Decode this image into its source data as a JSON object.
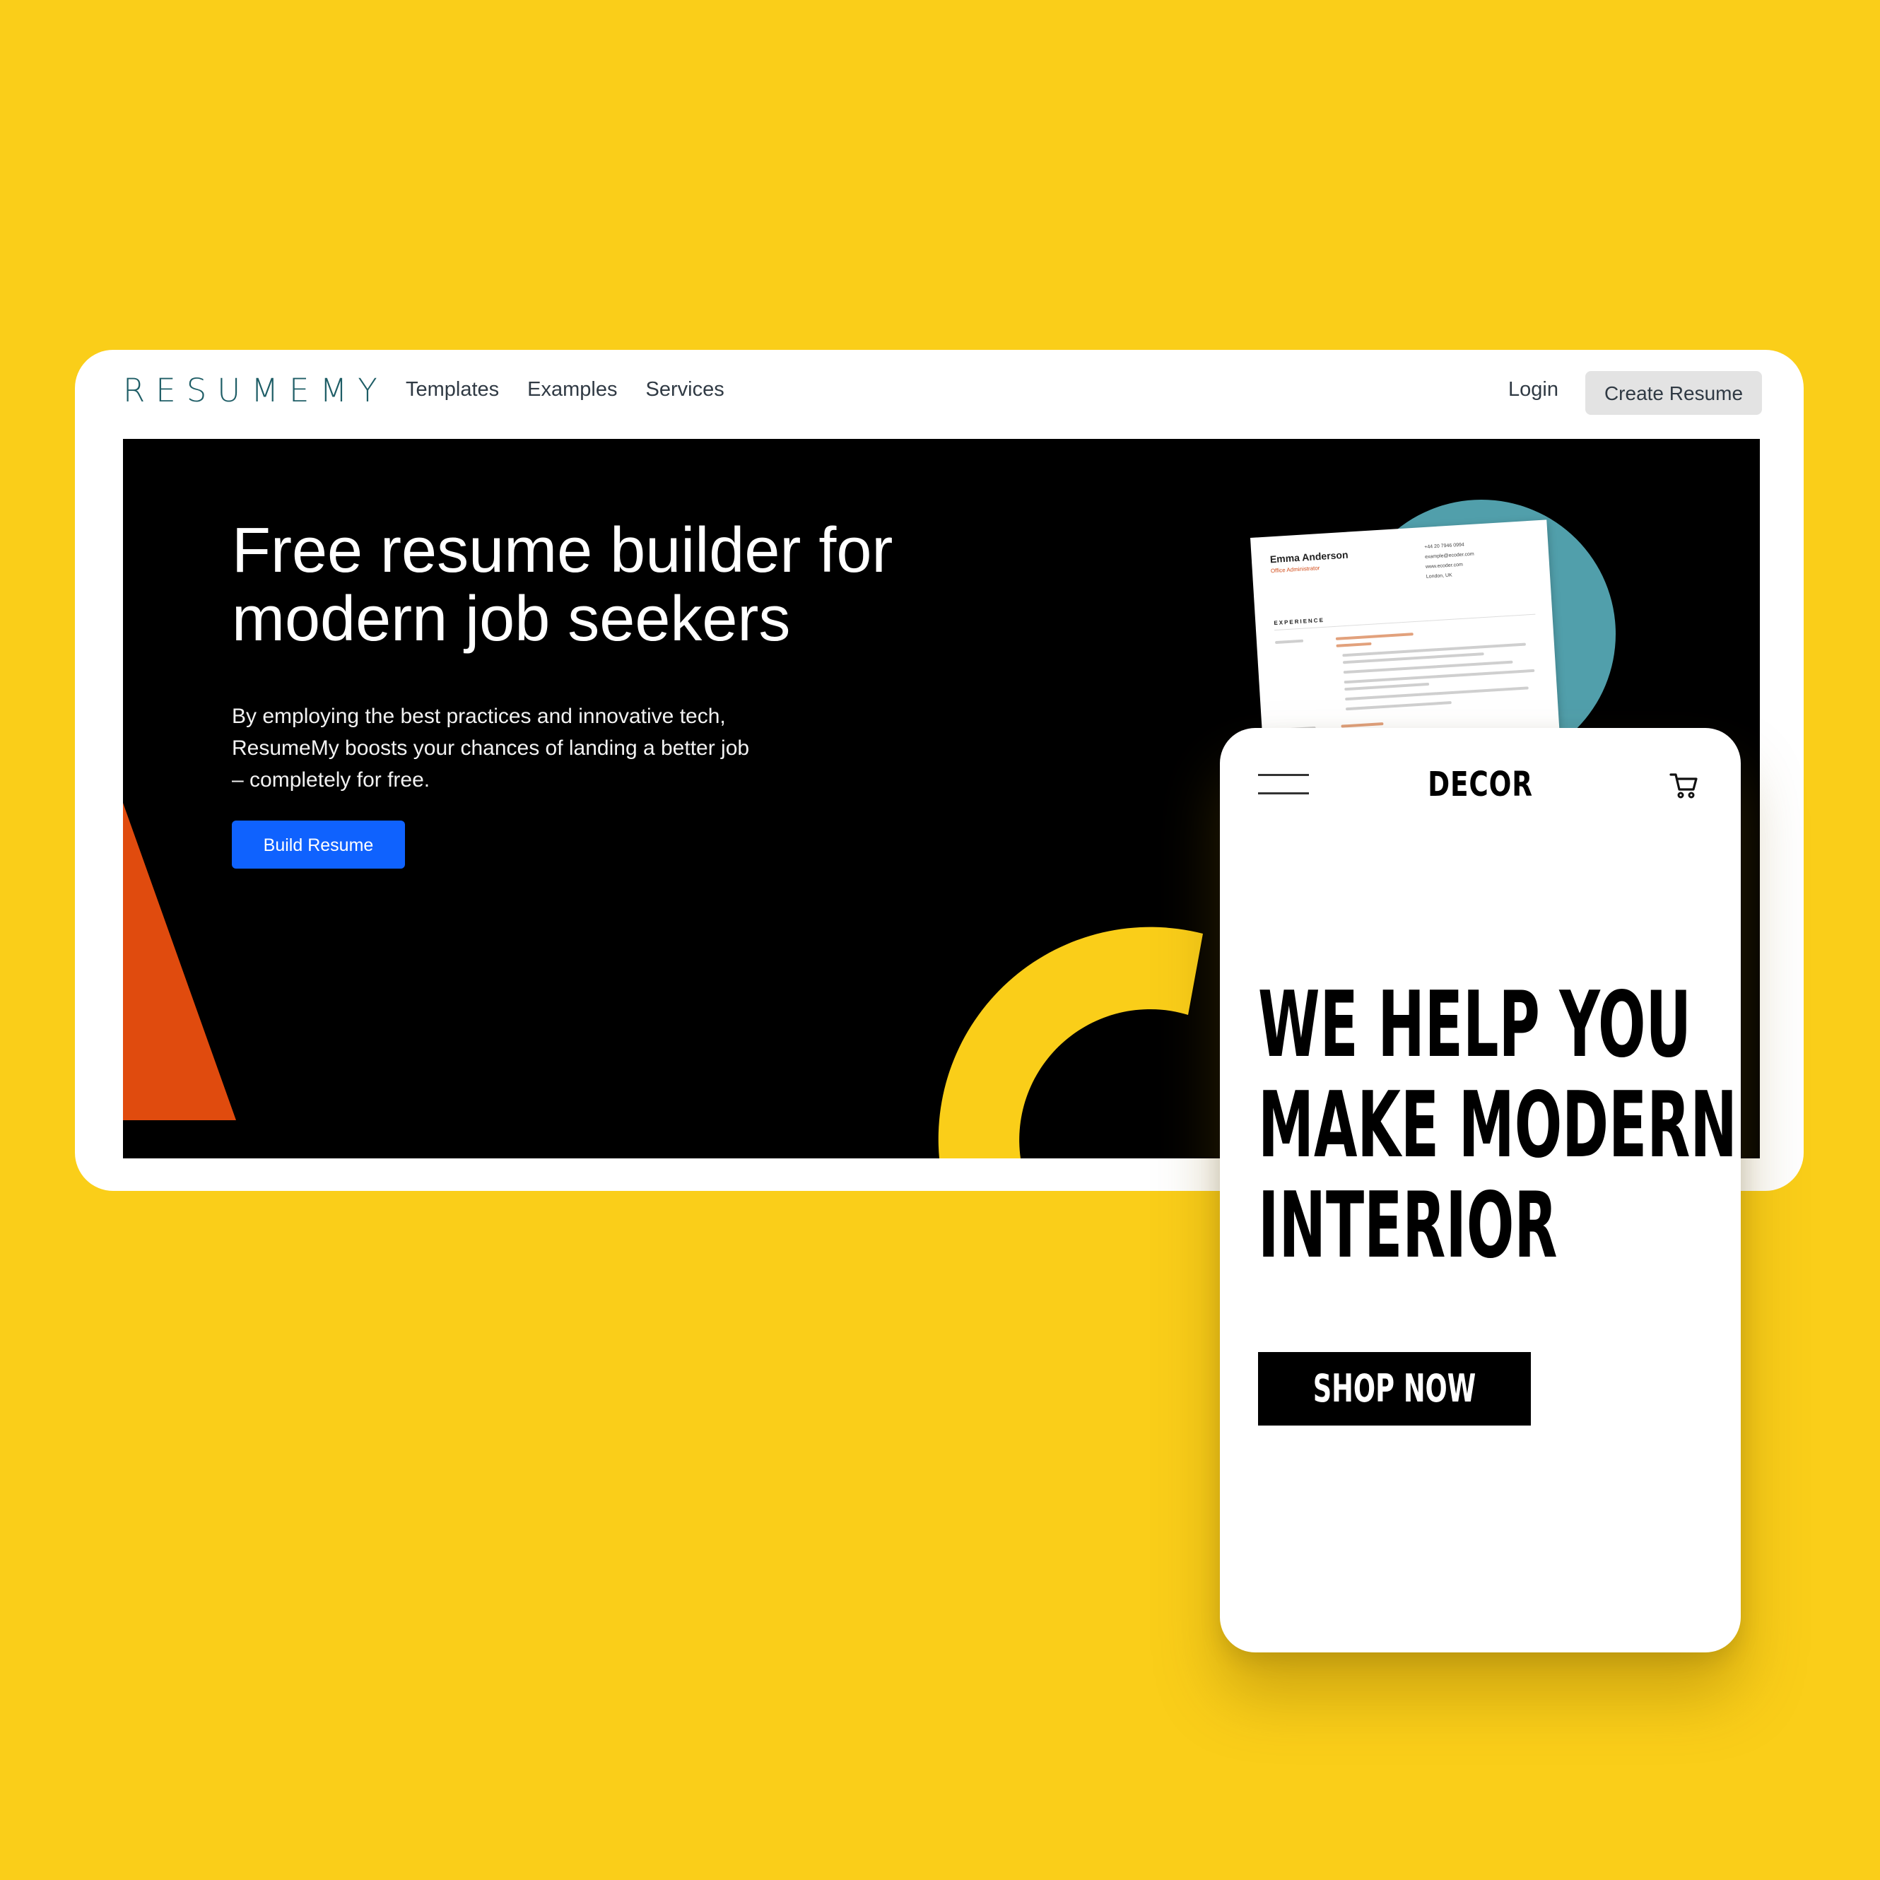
{
  "desktop": {
    "logo": "RESUMEMY",
    "nav": [
      "Templates",
      "Examples",
      "Services"
    ],
    "login": "Login",
    "create_button": "Create Resume",
    "hero": {
      "title_lines": [
        "Free resume builder for",
        "modern job seekers"
      ],
      "subtitle_lines": [
        "By employing the best practices and innovative tech,",
        "ResumeMy boosts your chances of landing a better job",
        "– completely for free."
      ],
      "cta": "Build Resume"
    },
    "resume_preview": {
      "name": "Emma Anderson",
      "role": "Office Administrator",
      "contact": [
        "+44 20 7946 0994",
        "example@ecoder.com",
        "www.ecoder.com",
        "London, UK"
      ],
      "section": "EXPERIENCE"
    }
  },
  "mobile": {
    "brand": "DECOR",
    "headline_lines": [
      "WE HELP YOU",
      "MAKE MODERN",
      "INTERIOR"
    ],
    "cta": "SHOP NOW"
  },
  "colors": {
    "background": "#FACE19",
    "hero_background": "#000000",
    "primary_button": "#0F62FE",
    "accent_orange": "#E04B0E",
    "accent_teal": "#519FAB",
    "accent_yellow": "#FACE19"
  },
  "icons": [
    "hamburger-menu-icon",
    "cart-icon"
  ]
}
